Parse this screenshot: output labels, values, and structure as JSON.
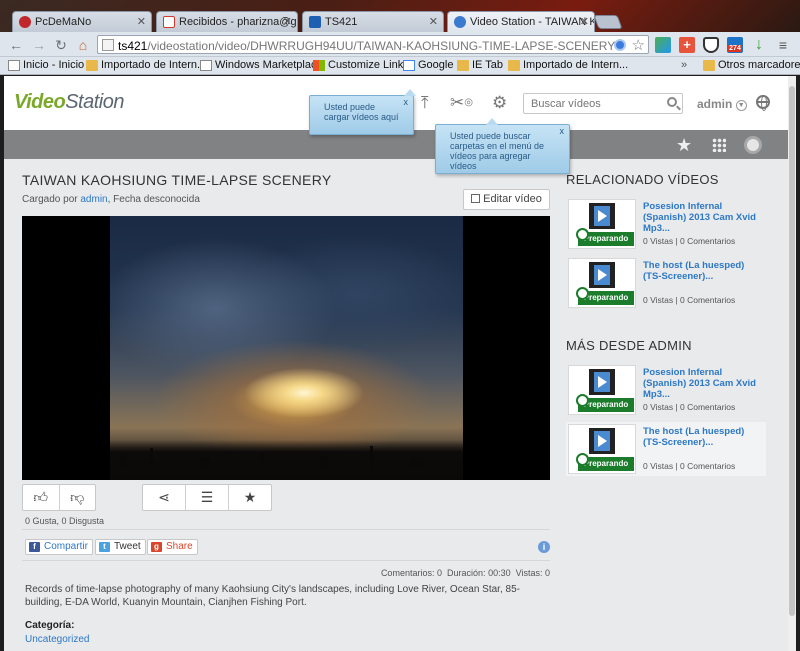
{
  "browser": {
    "tabs": [
      {
        "title": "PcDeMaNo",
        "icon_color": "#c0282b"
      },
      {
        "title": "Recibidos - pharizna@gm",
        "icon_color": "#d23b2b"
      },
      {
        "title": "TS421",
        "icon_color": "#1e5fb3"
      },
      {
        "title": "Video Station - TAIWAN K",
        "icon_color": "#3c7ad0"
      }
    ],
    "address": {
      "host": "ts421",
      "path": "/videostation/video/DHWRRUGH94UU/TAIWAN-KAOHSIUNG-TIME-LAPSE-SCENERY"
    },
    "extension_badge": "274",
    "bookmarks": [
      {
        "label": "Inicio - Inicio",
        "icon": "page-icon"
      },
      {
        "label": "Importado de Intern...",
        "icon": "folder-icon"
      },
      {
        "label": "Windows Marketplace",
        "icon": "page-icon"
      },
      {
        "label": "Customize Links",
        "icon": "windows-icon"
      },
      {
        "label": "Google",
        "icon": "google-icon"
      },
      {
        "label": "IE Tab",
        "icon": "folder-icon"
      },
      {
        "label": "Importado de Intern...",
        "icon": "folder-icon"
      }
    ],
    "other_bookmarks": "Otros marcadores",
    "overflow": "»"
  },
  "header": {
    "logo_part1": "Video",
    "logo_part2": "Station",
    "search_placeholder": "Buscar vídeos",
    "user": "admin",
    "tooltip_upload": "Usted puede cargar vídeos aquí",
    "tooltip_folders": "Usted puede buscar carpetas en el menú de vídeos para agregar vídeos",
    "tooltip_close": "x"
  },
  "video": {
    "title": "TAIWAN KAOHSIUNG TIME-LAPSE SCENERY",
    "uploaded_prefix": "Cargado por ",
    "uploaded_by": "admin",
    "uploaded_suffix": ", Fecha desconocida",
    "edit_label": "Editar vídeo",
    "likes_text": "0 Gusta, 0 Disgusta",
    "share_facebook": "Compartir",
    "share_twitter": "Tweet",
    "share_google": "Share",
    "stats": {
      "comments_label": "Comentarios:",
      "comments": "0",
      "duration_label": "Duración:",
      "duration": "00:30",
      "views_label": "Vistas:",
      "views": "0"
    },
    "description": "Records of time-lapse photography of many Kaohsiung City's landscapes, including Love River, Ocean Star, 85-building, E-DA World, Kuanyin Mountain, Cianjhen Fishing Port.",
    "category_label": "Categoría:",
    "category_value": "Uncategorized"
  },
  "related": {
    "title": "RELACIONADO VÍDEOS",
    "items": [
      {
        "title": "Posesion Infernal (Spanish) 2013 Cam Xvid Mp3...",
        "meta": "0 Vistas | 0 Comentarios",
        "status": "Preparando"
      },
      {
        "title": "The host (La huesped) (TS-Screener)...",
        "meta": "0 Vistas | 0 Comentarios",
        "status": "Preparando"
      }
    ]
  },
  "more": {
    "title": "MÁS DESDE ADMIN",
    "items": [
      {
        "title": "Posesion Infernal (Spanish) 2013 Cam Xvid Mp3...",
        "meta": "0 Vistas | 0 Comentarios",
        "status": "Preparando"
      },
      {
        "title": "The host (La huesped) (TS-Screener)...",
        "meta": "0 Vistas | 0 Comentarios",
        "status": "Preparando"
      }
    ]
  },
  "colors": {
    "accent_link": "#2c78c6",
    "logo_green": "#7aa92a",
    "status_green": "#1b7d2c",
    "tooltip_blue": "#9fcbe8"
  }
}
